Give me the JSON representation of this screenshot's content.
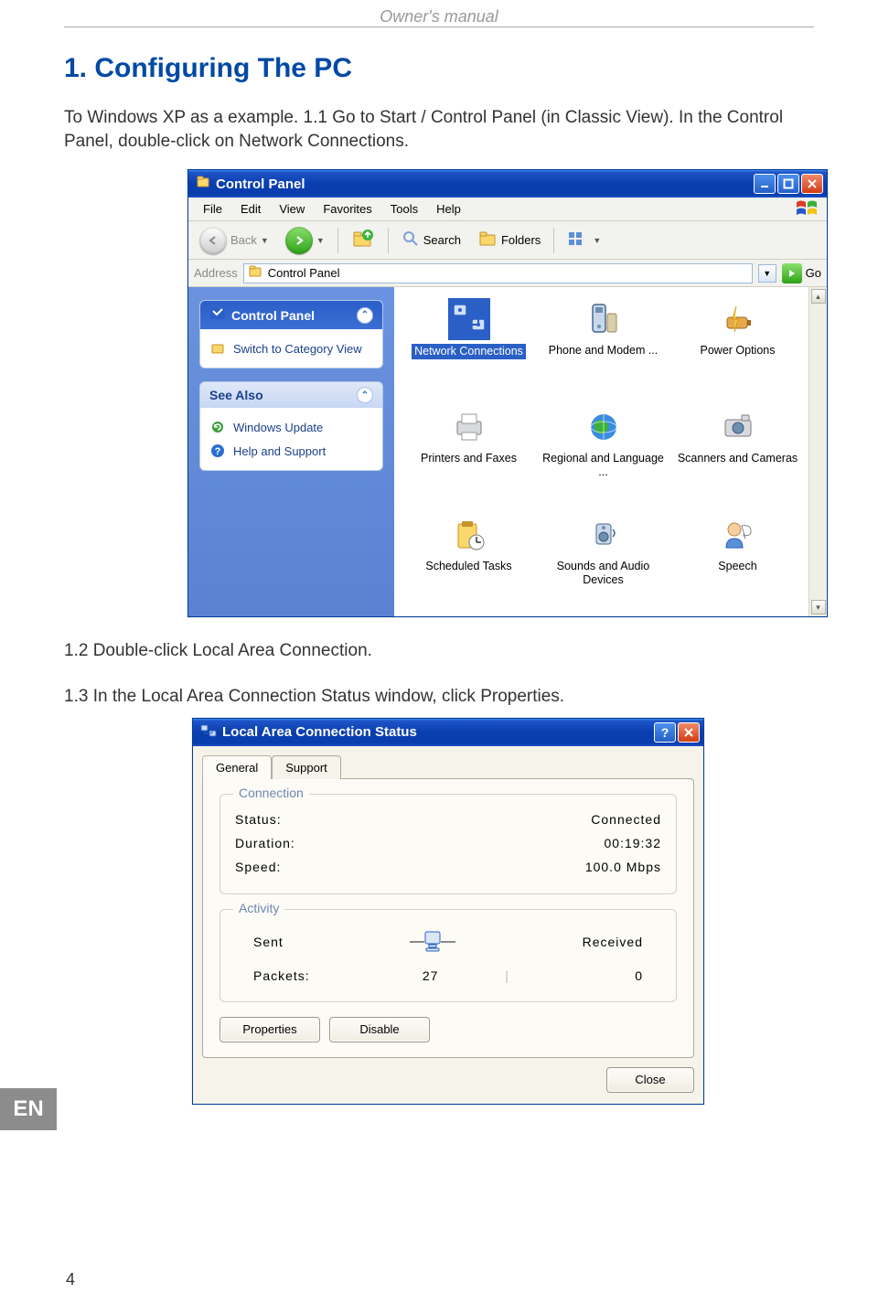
{
  "page": {
    "header": "Owner's manual",
    "number": "4",
    "lang_badge": "EN"
  },
  "doc": {
    "h1": "1. Configuring The PC",
    "intro": "To Windows XP as a example. 1.1 Go to Start / Control Panel (in Classic View). In the Control Panel, double-click on Network Connections.",
    "step12": "1.2 Double-click Local Area Connection.",
    "step13": "1.3 In the Local Area Connection Status window, click Properties."
  },
  "cp": {
    "title": "Control Panel",
    "menu": [
      "File",
      "Edit",
      "View",
      "Favorites",
      "Tools",
      "Help"
    ],
    "toolbar": {
      "back": "Back",
      "search": "Search",
      "folders": "Folders"
    },
    "address": {
      "label": "Address",
      "value": "Control Panel",
      "go": "Go"
    },
    "sidebar": {
      "panel1_title": "Control Panel",
      "switch_link": "Switch to Category View",
      "panel2_title": "See Also",
      "links": [
        "Windows Update",
        "Help and Support"
      ]
    },
    "items": [
      {
        "label": "Network Connections",
        "selected": true,
        "icon": "network-icon"
      },
      {
        "label": "Phone and Modem ...",
        "selected": false,
        "icon": "phone-icon"
      },
      {
        "label": "Power Options",
        "selected": false,
        "icon": "power-icon"
      },
      {
        "label": "Printers and Faxes",
        "selected": false,
        "icon": "printer-icon"
      },
      {
        "label": "Regional and Language ...",
        "selected": false,
        "icon": "globe-icon"
      },
      {
        "label": "Scanners and Cameras",
        "selected": false,
        "icon": "camera-icon"
      },
      {
        "label": "Scheduled Tasks",
        "selected": false,
        "icon": "tasks-icon"
      },
      {
        "label": "Sounds and Audio Devices",
        "selected": false,
        "icon": "sound-icon"
      },
      {
        "label": "Speech",
        "selected": false,
        "icon": "speech-icon"
      }
    ]
  },
  "lac": {
    "title": "Local Area Connection Status",
    "tabs": [
      "General",
      "Support"
    ],
    "conn_legend": "Connection",
    "activity_legend": "Activity",
    "rows": {
      "status_k": "Status:",
      "status_v": "Connected",
      "duration_k": "Duration:",
      "duration_v": "00:19:32",
      "speed_k": "Speed:",
      "speed_v": "100.0 Mbps"
    },
    "activity": {
      "sent": "Sent",
      "received": "Received",
      "packets_k": "Packets:",
      "packets_sent": "27",
      "packets_recv": "0"
    },
    "buttons": {
      "properties": "Properties",
      "disable": "Disable",
      "close": "Close"
    }
  }
}
